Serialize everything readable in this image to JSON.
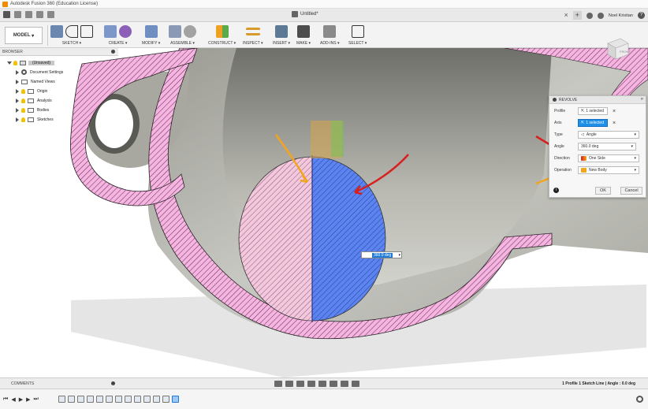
{
  "app": {
    "title": "Autodesk Fusion 360 (Education License)",
    "document_tab": "Untitled*",
    "user": "Noel Kristian",
    "help": "?"
  },
  "ribbon": {
    "workspace": "MODEL",
    "groups": [
      "SKETCH",
      "CREATE",
      "MODIFY",
      "ASSEMBLE",
      "CONSTRUCT",
      "INSPECT",
      "INSERT",
      "MAKE",
      "ADD-INS",
      "SELECT"
    ]
  },
  "browser": {
    "header": "BROWSER",
    "root": "(Unsaved)",
    "items": [
      "Document Settings",
      "Named Views",
      "Origin",
      "Analysis",
      "Bodies",
      "Sketches"
    ]
  },
  "revolve": {
    "title": "REVOLVE",
    "profile_label": "Profile",
    "profile_value": "1 selected",
    "axis_label": "Axis",
    "axis_value": "1 selected",
    "type_label": "Type",
    "type_value": "Angle",
    "angle_label": "Angle",
    "angle_value": "360.0 deg",
    "direction_label": "Direction",
    "direction_value": "One Side",
    "operation_label": "Operation",
    "operation_value": "New Body",
    "ok": "OK",
    "cancel": "Cancel"
  },
  "viewport": {
    "angle_input": "360.0 deg",
    "viewcube_face": "FRONT"
  },
  "bottom": {
    "comments": "COMMENTS",
    "status": "1 Profile 1 Sketch Line | Angle : 0.0 deg"
  },
  "colors": {
    "accent_blue": "#1e90e8",
    "section_pink": "#f6b4e0",
    "profile_blue": "#5b84f0",
    "arrow_red": "#d8201e",
    "arrow_orange": "#f2a51d"
  }
}
